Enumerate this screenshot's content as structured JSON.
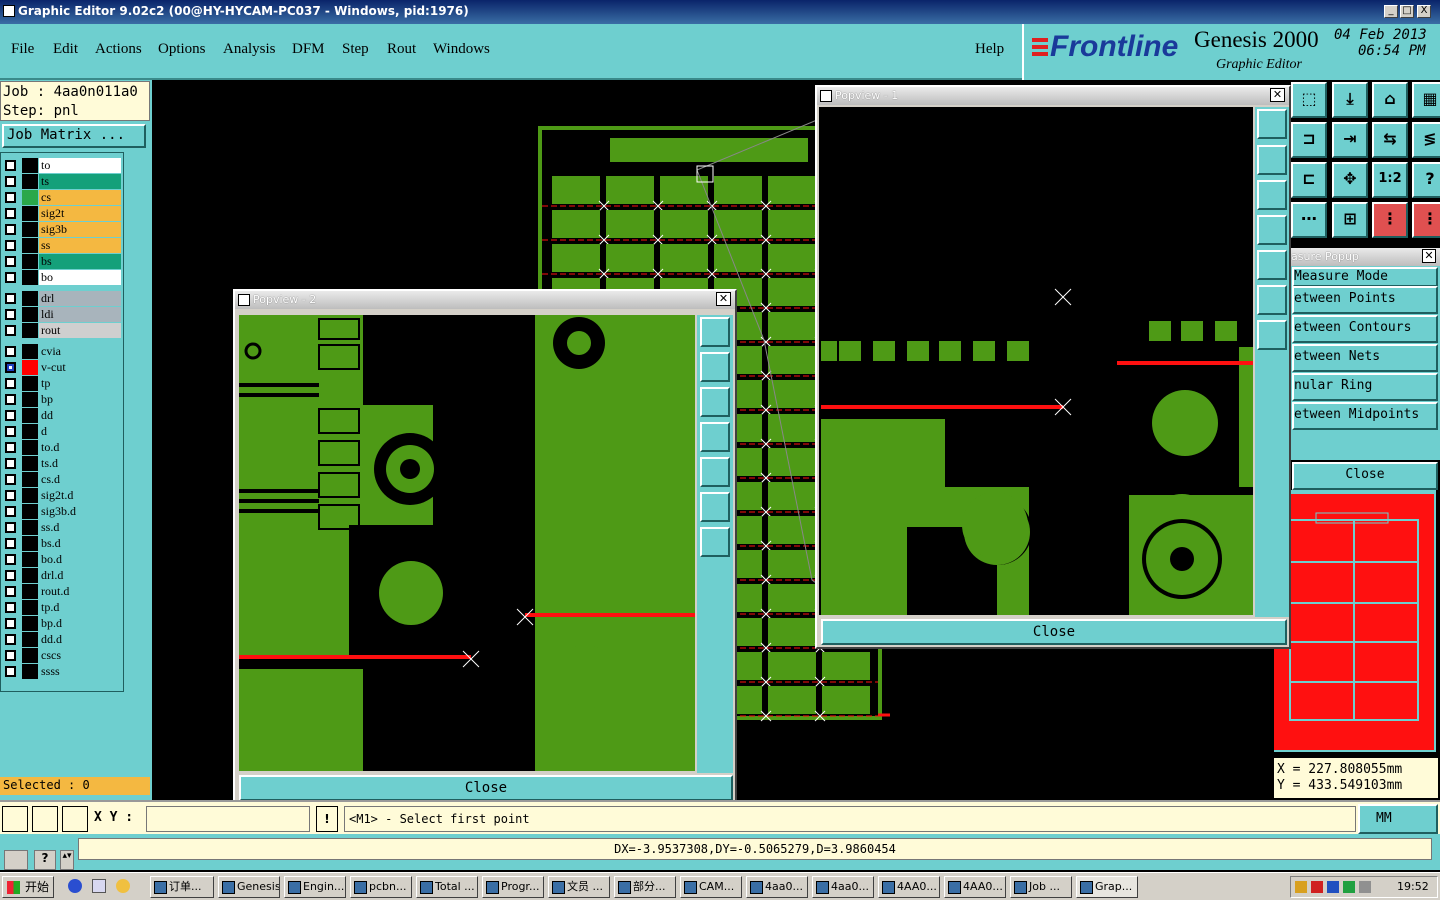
{
  "window": {
    "title": "Graphic Editor 9.02c2 (00@HY-HYCAM-PC037 - Windows, pid:1976)",
    "minimize": "_",
    "maximize": "□",
    "close": "X"
  },
  "menu": {
    "items": [
      "File",
      "Edit",
      "Actions",
      "Options",
      "Analysis",
      "DFM",
      "Step",
      "Rout",
      "Windows"
    ],
    "help": "Help"
  },
  "brand": {
    "logo": "Frontline",
    "product": "Genesis 2000",
    "subtitle": "Graphic Editor",
    "date": "04 Feb 2013",
    "time": "06:54 PM"
  },
  "job": {
    "job_label": "Job : 4aa0n011a0",
    "step_label": "Step: pnl",
    "matrix_button": "Job Matrix ..."
  },
  "layers_group1": [
    {
      "name": "to",
      "color": "#ffffff"
    },
    {
      "name": "ts",
      "color": "#14a07a"
    },
    {
      "name": "cs",
      "color": "#f4b841",
      "swatch": "#2aa84a"
    },
    {
      "name": "sig2t",
      "color": "#f4b841"
    },
    {
      "name": "sig3b",
      "color": "#f4b841"
    },
    {
      "name": "ss",
      "color": "#f4b841"
    },
    {
      "name": "bs",
      "color": "#14a07a"
    },
    {
      "name": "bo",
      "color": "#ffffff"
    }
  ],
  "layers_group2": [
    {
      "name": "drl",
      "color": "#a8b4bc"
    },
    {
      "name": "ldi",
      "color": "#a8b4bc"
    },
    {
      "name": "rout",
      "color": "#cfcfcf"
    }
  ],
  "layers_group3": [
    {
      "name": "cvia"
    },
    {
      "name": "v-cut",
      "swatch": "#ff0000",
      "active": true
    },
    {
      "name": "tp"
    },
    {
      "name": "bp"
    },
    {
      "name": "dd"
    },
    {
      "name": "d"
    },
    {
      "name": "to.d"
    },
    {
      "name": "ts.d"
    },
    {
      "name": "cs.d"
    },
    {
      "name": "sig2t.d"
    },
    {
      "name": "sig3b.d"
    },
    {
      "name": "ss.d"
    },
    {
      "name": "bs.d"
    },
    {
      "name": "bo.d"
    },
    {
      "name": "drl.d"
    },
    {
      "name": "rout.d"
    },
    {
      "name": "tp.d"
    },
    {
      "name": "bp.d"
    },
    {
      "name": "dd.d"
    },
    {
      "name": "cscs"
    },
    {
      "name": "ssss"
    }
  ],
  "selected": "Selected : 0",
  "popview1": {
    "title": "Popview - 1",
    "close": "Close"
  },
  "popview2": {
    "title": "Popview - 2",
    "close": "Close"
  },
  "measure": {
    "title": "Measure Popup",
    "title_visible": "asure Popup",
    "items": [
      "Measure Mode",
      "etween Points",
      "etween Contours",
      "etween Nets",
      "nular Ring",
      "etween Midpoints"
    ],
    "close": "Close"
  },
  "coords": {
    "x": "X  =  227.808055mm",
    "y": "Y  =  433.549103mm"
  },
  "command": {
    "xy_label": "X Y :",
    "xy_value": "",
    "prompt": "<M1> - Select first point",
    "units": "MM"
  },
  "status": {
    "message": "DX=-3.9537308,DY=-0.5065279,D=3.9860454"
  },
  "taskbar": {
    "start": "开始",
    "tasks": [
      "订单...",
      "Genesis",
      "Engin...",
      "pcbn...",
      "Total ...",
      "Progr...",
      "文员 ...",
      "部分...",
      "CAM...",
      "4aa0...",
      "4aa0...",
      "4AA0...",
      "4AA0...",
      "Job ...",
      "Grap..."
    ],
    "clock": "19:52"
  },
  "colors": {
    "panel": "#6ecfcf",
    "copper": "#4e9a16",
    "vcut": "#ff1010"
  }
}
